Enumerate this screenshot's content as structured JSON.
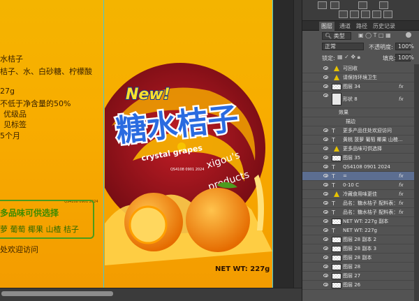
{
  "document": {
    "product_name_line": "水桔子",
    "ingredients_line": "桔子、水、白砂糖、柠檬酸",
    "weight_line": "27g",
    "content_line": "不低于净含量的50%",
    "grade_line": "优级品",
    "label_line": "见标签",
    "shelf_line": "5个月",
    "flavor_title": "多品味可供选择",
    "flavors_line": "萝  葡萄  椰果  山楂  桔子",
    "visit_line": "处欢迎访问",
    "code_small": "QS4108 0901 2024",
    "center_code": "QS4108 0901 2024",
    "new_badge": "New!",
    "brand_title": "糖水桔子",
    "subtitle": "crystal grapes",
    "brand_line1": "xigou's",
    "brand_line2": "products",
    "net_wt": "NET WT: 227g"
  },
  "panel": {
    "tabs": [
      "图层",
      "通道",
      "路径",
      "历史记录"
    ],
    "filter_label": "类型",
    "blend_mode": "正常",
    "opacity_label": "不透明度:",
    "opacity_value": "100%",
    "lock_label": "锁定:",
    "fill_label": "填充:",
    "fill_value": "100%"
  },
  "layers": [
    {
      "name": "可回收",
      "kind": "warn",
      "fx": ""
    },
    {
      "name": "请保持环境卫生",
      "kind": "warn",
      "fx": ""
    },
    {
      "name": "图层 34",
      "kind": "thumb",
      "fx": "fx"
    },
    {
      "name": "形状 8",
      "kind": "shape",
      "fx": "fx"
    },
    {
      "name": "效果",
      "kind": "effect",
      "fx": ""
    },
    {
      "name": "描边",
      "kind": "effect2",
      "fx": ""
    },
    {
      "name": "更多产品住处欢迎访问",
      "kind": "text",
      "fx": ""
    },
    {
      "name": "黄桃 菠萝 葡萄 椰果 山楂...",
      "kind": "text",
      "fx": ""
    },
    {
      "name": "更多品味可供选择",
      "kind": "warn",
      "fx": ""
    },
    {
      "name": "图层 35",
      "kind": "thumb",
      "fx": ""
    },
    {
      "name": "QS4108 0901 2024",
      "kind": "text",
      "fx": ""
    },
    {
      "name": "=",
      "kind": "text-sel",
      "fx": "fx"
    },
    {
      "name": "0-10 C",
      "kind": "text",
      "fx": "fx"
    },
    {
      "name": "冷藏食用味更佳",
      "kind": "warn",
      "fx": "fx"
    },
    {
      "name": "品名：糖水桔子 配料表：",
      "kind": "text",
      "fx": "fx"
    },
    {
      "name": "品名：糖水桔子 配料表：",
      "kind": "text",
      "fx": "fx"
    },
    {
      "name": "NET WT: 227g 副本",
      "kind": "thumb",
      "fx": ""
    },
    {
      "name": "NET WT: 227g",
      "kind": "text",
      "fx": ""
    },
    {
      "name": "图层 28 副本 2",
      "kind": "thumb",
      "fx": ""
    },
    {
      "name": "图层 28 副本 3",
      "kind": "thumb",
      "fx": ""
    },
    {
      "name": "图层 28 副本",
      "kind": "thumb",
      "fx": ""
    },
    {
      "name": "图层 28",
      "kind": "thumb",
      "fx": ""
    },
    {
      "name": "图层 27",
      "kind": "thumb",
      "fx": ""
    },
    {
      "name": "图层 26",
      "kind": "thumb",
      "fx": ""
    }
  ],
  "colors": {
    "background": "#f4b400",
    "swirl": "#8b1018",
    "title_blue": "#1e5bc0",
    "green": "#3d8b00",
    "selection": "#5c6e91"
  }
}
